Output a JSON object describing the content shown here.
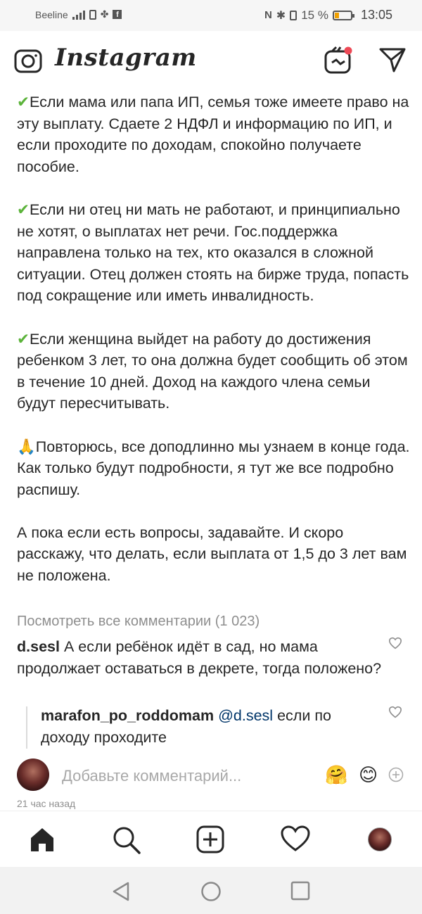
{
  "status": {
    "carrier": "Beeline",
    "battery": "15 %",
    "time": "13:05"
  },
  "header": {
    "logo": "Instagram",
    "icons": [
      "camera-icon",
      "igtv-icon",
      "direct-message-icon"
    ]
  },
  "post": {
    "paragraphs": [
      {
        "emoji": "✔",
        "text": "Если мама или папа ИП, семья тоже имеете право на эту выплату. Сдаете 2 НДФЛ и информацию по ИП, и если проходите по доходам, спокойно получаете пособие."
      },
      {
        "emoji": "✔",
        "text": "Если ни отец ни мать не работают, и принципиально не хотят, о выплатах нет речи. Гос.поддержка направлена только на тех, кто оказался в сложной ситуации. Отец должен стоять на бирже труда, попасть под сокращение или иметь инвалидность."
      },
      {
        "emoji": "✔",
        "text": "Если женщина выйдет на работу до достижения ребенком 3 лет, то она должна будет сообщить об этом в течение 10 дней. Доход на каждого члена семьи будут пересчитывать."
      },
      {
        "emoji": "🙏",
        "text": "Повторюсь, все доподлинно мы узнаем в конце года. Как только будут подробности, я тут же все подробно распишу."
      },
      {
        "emoji": "",
        "text": "А пока если есть вопросы, задавайте. И скоро расскажу, что делать, если выплата от 1,5 до 3 лет вам не положена."
      }
    ]
  },
  "comments": {
    "view_all": "Посмотреть все комментарии (1 023)",
    "first": {
      "user": "d.sesl",
      "text": "А если ребёнок идёт в сад, но мама продолжает оставаться в декрете, тогда положено?"
    },
    "reply": {
      "user": "marafon_po_roddomam",
      "mention": "@d.sesl",
      "text": "если по доходу проходите"
    }
  },
  "add_comment": {
    "placeholder": "Добавьте комментарий...",
    "emoji1": "🤗",
    "emoji2": "😊"
  },
  "timestamp": "21 час назад",
  "tabbar": [
    "home-icon",
    "search-icon",
    "new-post-icon",
    "activity-heart-icon",
    "profile-avatar"
  ],
  "colors": {
    "check": "#5bb33a",
    "mention": "#003569",
    "muted": "#8e8e8e"
  }
}
